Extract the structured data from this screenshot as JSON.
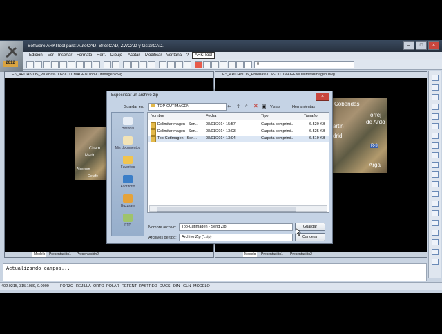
{
  "app": {
    "title": "Software ARKITool para: AutoCAD, BricsCAD, ZWCAD y GstarCAD.",
    "logo_year": "2012",
    "window_buttons": [
      "–",
      "□",
      "×"
    ]
  },
  "menu": [
    "Edición",
    "Ver",
    "Insertar",
    "Formato",
    "Herr.",
    "Dibujo",
    "Acotar",
    "Modificar",
    "Ventana",
    "?",
    "ARKITool"
  ],
  "toolbar": {
    "layer_value": "0"
  },
  "drawing_left": {
    "path": "E:\\_ARCHIVOS_Pruebas\\TOP-CUTIMAGEN\\Top-CutImagen.dwg",
    "tabs": [
      "Modelo",
      "Presentación1",
      "Presentación2"
    ],
    "map_labels": [
      "Cham",
      "Madri",
      "Alcorcon",
      "Getafe"
    ]
  },
  "drawing_right": {
    "path": "E:\\_ARCHIVOS_Pruebas\\TOP-CUTIMAGEN\\DelimitarImagen.dwg",
    "tabs": [
      "Modelo",
      "Presentación1",
      "Presentación2"
    ],
    "map_labels": [
      "Cobendas",
      "Torrej",
      "de Ardo",
      "artin",
      "drid",
      "Arga",
      "R-3"
    ]
  },
  "dialog": {
    "title": "Especificar un archivo zip",
    "save_in_label": "Guardar en:",
    "save_in_value": "TOP-CUTIMAGEN",
    "views_label": "Vistas",
    "tools_label": "Herramientas",
    "places": [
      "Historial",
      "Mis documentos",
      "Favoritos",
      "Escritorio",
      "Buzzsaw",
      "FTP"
    ],
    "columns": [
      "Nombre",
      "Fecha",
      "Tipo",
      "Tamaño"
    ],
    "rows": [
      {
        "name": "DelimitarImagen - Sen...",
        "date": "08/01/2014 15:57",
        "type": "Carpeta comprimi...",
        "size": "6.520 KB"
      },
      {
        "name": "DelimitarImagen - Sen...",
        "date": "08/01/2014 13:03",
        "type": "Carpeta comprimi...",
        "size": "6.525 KB"
      },
      {
        "name": "Top-CutImagen - Sen...",
        "date": "08/01/2014 13:04",
        "type": "Carpeta comprimi...",
        "size": "6.519 KB"
      }
    ],
    "filename_label": "Nombre archivo:",
    "filename_value": "Top-CutImagen - Send Zip",
    "filetype_label": "Archivos de tipo:",
    "filetype_value": "Archivo Zip (*.zip)",
    "save_button": "Guardar",
    "cancel_button": "Cancelar"
  },
  "command_line": {
    "text": "Actualizando campos..."
  },
  "status": {
    "coords": "402.0215, 315.1089, 0.0000",
    "toggles": [
      "FORZC",
      "REJILLA",
      "ORTO",
      "POLAR",
      "REFENT",
      "RASTREO",
      "DUCS",
      "DIN",
      "GLN",
      "MODELO"
    ]
  }
}
